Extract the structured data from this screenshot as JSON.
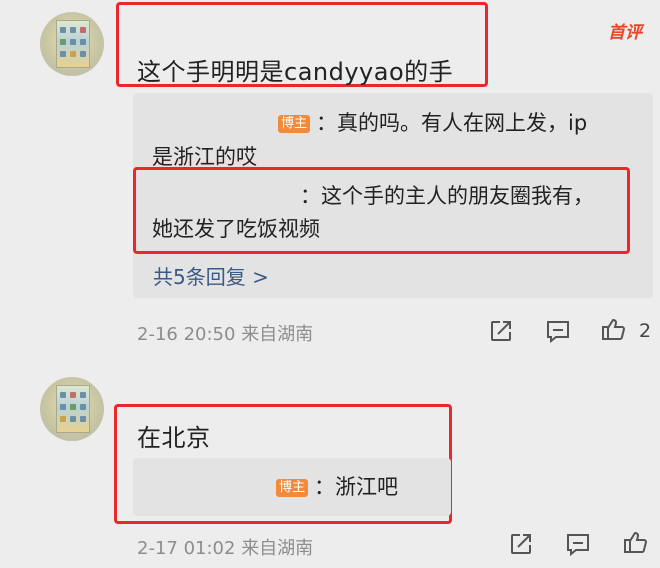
{
  "watermark": "首评",
  "comments": [
    {
      "text": "这个手明明是candyyao的手",
      "replies": [
        {
          "badge": "博主",
          "text_line1": "：真的吗。有人在网上发，ip",
          "text_line2": "是浙江的哎"
        },
        {
          "text_line1": "：这个手的主人的朋友圈我有，",
          "text_line2": "她还发了吃饭视频"
        }
      ],
      "more_replies": "共5条回复 >",
      "timestamp": "2-16 20:50",
      "location": "来自湖南",
      "like_count": "2"
    },
    {
      "text": "在北京",
      "replies": [
        {
          "badge": "博主",
          "text": "：浙江吧"
        }
      ],
      "timestamp": "2-17 01:02",
      "location": "来自湖南"
    }
  ]
}
